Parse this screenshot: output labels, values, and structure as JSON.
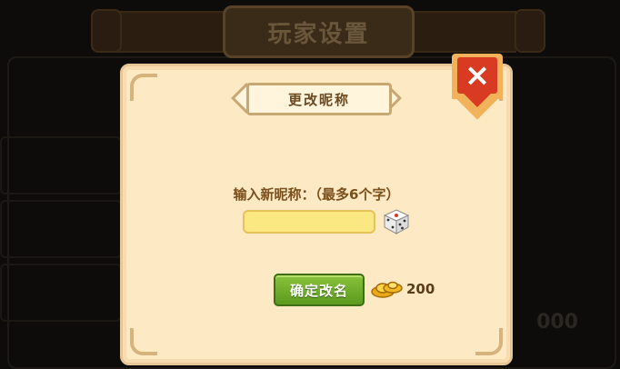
{
  "background": {
    "title": "玩家设置",
    "number_text": "000"
  },
  "dialog": {
    "title": "更改昵称",
    "prompt": "输入新昵称：（最多6个字）",
    "name_input": {
      "value": "",
      "placeholder": ""
    },
    "confirm_label": "确定改名",
    "cost_value": "200",
    "close_label": "×"
  },
  "icons": {
    "close": "close-x-icon",
    "dice": "dice-icon",
    "gold": "gold-ingot-icon"
  },
  "colors": {
    "dialog_bg": "#fde9c4",
    "confirm_green": "#6fae28",
    "close_red": "#d93b22",
    "input_yellow": "#fbe882"
  }
}
